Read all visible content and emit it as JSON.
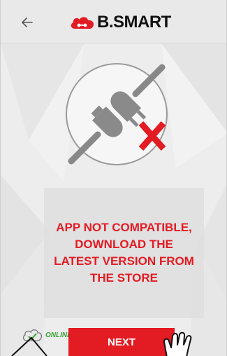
{
  "header": {
    "back_icon": "arrow-left-icon",
    "logo_icon": "cloud-logo-icon",
    "logo_text": "B.SMART"
  },
  "main": {
    "illustration_icon": "unplugged-plug-icon",
    "error_mark_icon": "red-x-icon",
    "message": "APP NOT COMPATIBLE, DOWNLOAD THE LATEST VERSION FROM THE STORE"
  },
  "footer": {
    "status_icon": "cloud-check-icon",
    "status_label": "ONLINE",
    "next_label": "NEXT",
    "pointer_icon": "hand-pointer-icon"
  },
  "colors": {
    "accent": "#e31b23",
    "online": "#3aa335",
    "background": "#ededed"
  }
}
